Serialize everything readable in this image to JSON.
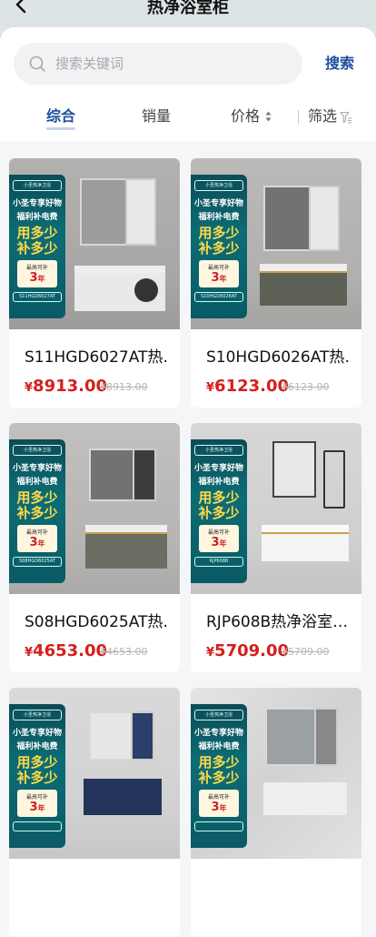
{
  "header": {
    "title": "热净浴室柜"
  },
  "search": {
    "placeholder": "搜索关键词",
    "button_label": "搜索"
  },
  "sort_tabs": {
    "all": "综合",
    "sales": "销量",
    "price": "价格",
    "filter": "筛选"
  },
  "badge": {
    "logo": "小圣热净卫浴",
    "line1": "小圣专享好物",
    "line2": "福利补电费",
    "big1": "用多少",
    "big2": "补多少",
    "warranty_label": "最高可补",
    "warranty_years": "3",
    "warranty_unit": "年"
  },
  "products": [
    {
      "title": "S11HGD6027AT热…",
      "price": "8913.00",
      "original_price": "¥8913.00",
      "code": "S11HGD6027AT",
      "currency": "¥"
    },
    {
      "title": "S10HGD6026AT热…",
      "price": "6123.00",
      "original_price": "¥6123.00",
      "code": "S10HGD6026AT",
      "currency": "¥"
    },
    {
      "title": "S08HGD6025AT热…",
      "price": "4653.00",
      "original_price": "¥4653.00",
      "code": "S08HGD6025AT",
      "currency": "¥"
    },
    {
      "title": "RJP608B热净浴室…",
      "price": "5709.00",
      "original_price": "¥5709.00",
      "code": "RJP608B",
      "currency": "¥"
    },
    {
      "title": "",
      "price": "",
      "original_price": "",
      "code": "",
      "currency": ""
    },
    {
      "title": "",
      "price": "",
      "original_price": "",
      "code": "",
      "currency": ""
    }
  ],
  "colors": {
    "accent": "#1e4fa0",
    "price": "#d4201c",
    "badge": "#0b6d74"
  }
}
